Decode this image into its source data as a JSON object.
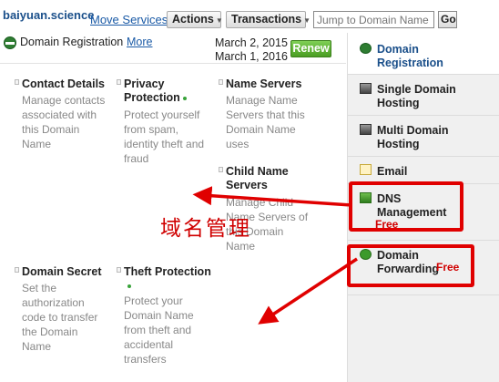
{
  "topbar": {
    "domain": "baiyuan.science",
    "move_services": "Move Services",
    "actions": "Actions",
    "transactions": "Transactions",
    "jump_placeholder": "Jump to Domain Name",
    "go": "Go"
  },
  "registration": {
    "label": "Domain Registration",
    "more": "More",
    "date_registered": "March 2, 2015",
    "date_expires": "March 1, 2016",
    "renew": "Renew"
  },
  "features": [
    {
      "title": "Contact Details",
      "desc": [
        "Manage contacts",
        "associated with",
        "this Domain",
        "Name"
      ]
    },
    {
      "title": [
        "Privacy",
        "Protection"
      ],
      "desc": [
        "Protect yourself",
        "from spam,",
        "identity theft and",
        "fraud"
      ]
    },
    {
      "title": "Name Servers",
      "desc": [
        "Manage Name",
        "Servers that this",
        "Domain Name",
        "uses"
      ]
    },
    {
      "title": [
        "Child Name",
        "Servers"
      ],
      "desc": [
        "Manage Child",
        "Name Servers of",
        "this Domain",
        "Name"
      ]
    },
    {
      "title": "Domain Secret",
      "desc": [
        "Set the",
        "authorization",
        "code to transfer",
        "the Domain",
        "Name"
      ]
    },
    {
      "title": "Theft Protection",
      "desc": [
        "Protect your",
        "Domain Name",
        "from theft and",
        "accidental",
        "transfers"
      ]
    }
  ],
  "sidebar": [
    {
      "label": [
        "Domain",
        "Registration"
      ],
      "icon": "globe-icon",
      "active": true
    },
    {
      "label": [
        "Single Domain",
        "Hosting"
      ],
      "icon": "server-icon"
    },
    {
      "label": [
        "Multi Domain",
        "Hosting"
      ],
      "icon": "server-icon"
    },
    {
      "label": [
        "Email"
      ],
      "icon": "mail-icon"
    },
    {
      "label": [
        "DNS",
        "Management"
      ],
      "icon": "dns-icon",
      "badge": "Free"
    },
    {
      "label": [
        "Domain",
        "Forwarding"
      ],
      "icon": "forward-icon",
      "badge": "Free"
    }
  ],
  "annotation": {
    "chinese_label": "域名管理",
    "color": "#e00000"
  },
  "colors": {
    "link": "#1a5aa6",
    "renew_green": "#4a9d23",
    "sidebar_bg": "#f0f0f0",
    "annotation_red": "#e00000"
  }
}
